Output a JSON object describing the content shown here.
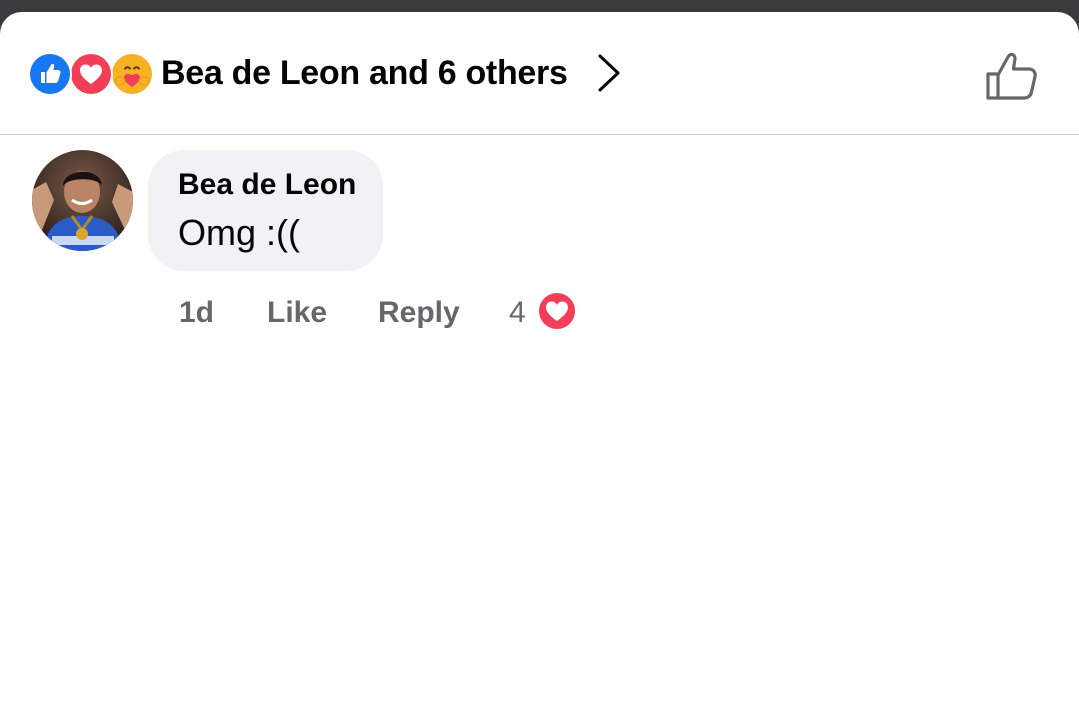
{
  "header": {
    "reactions": [
      {
        "type": "like",
        "icon": "like-reaction-icon",
        "color": "#1877f2"
      },
      {
        "type": "love",
        "icon": "love-reaction-icon",
        "color": "#f33e58"
      },
      {
        "type": "care",
        "icon": "care-reaction-icon",
        "color": "#f7b125"
      }
    ],
    "reactors_text": "Bea de Leon and 6 others",
    "chevron_icon": "chevron-right-icon",
    "like_icon": "thumbs-up-outline-icon"
  },
  "comment": {
    "author": "Bea de Leon",
    "text": "Omg :((",
    "avatar_icon": "avatar",
    "bubble_color": "#f0f2f5",
    "actions": {
      "time": "1d",
      "like_label": "Like",
      "reply_label": "Reply",
      "reaction_count": "4",
      "reaction_icon": "love-reaction-icon"
    }
  }
}
